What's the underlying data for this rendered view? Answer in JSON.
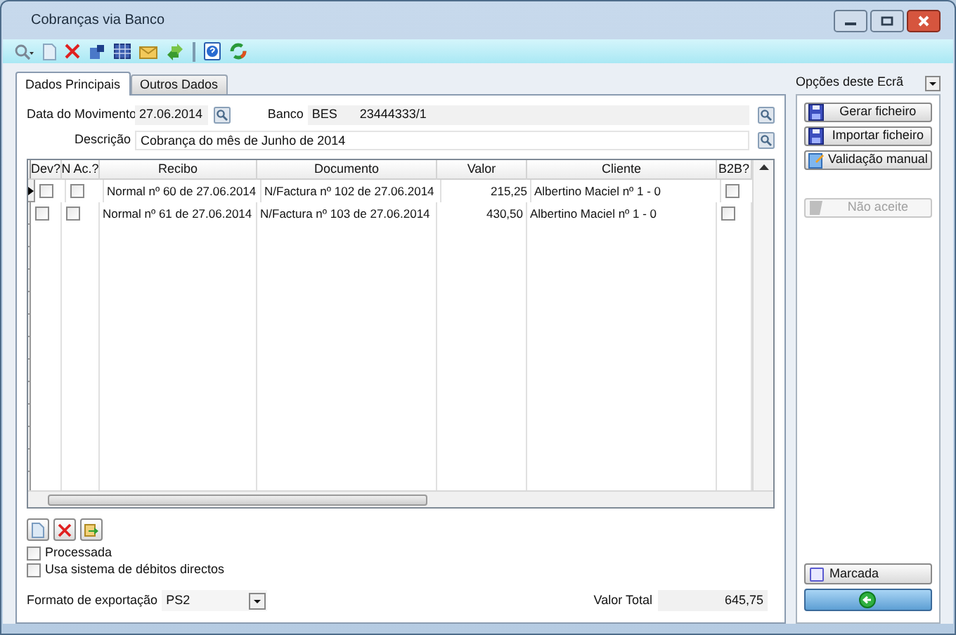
{
  "window": {
    "title": "Cobranças via Banco"
  },
  "tabs": [
    {
      "label": "Dados Principais",
      "selected": true
    },
    {
      "label": "Outros Dados",
      "selected": false
    }
  ],
  "fields": {
    "data_label": "Data do Movimento",
    "data_value": "27.06.2014",
    "banco_label": "Banco",
    "banco_code": "BES",
    "banco_account": "23444333/1",
    "descricao_label": "Descrição",
    "descricao_value": "Cobrança do mês de Junho de 2014"
  },
  "table": {
    "columns": [
      "Dev?",
      "N Ac.?",
      "Recibo",
      "Documento",
      "Valor",
      "Cliente",
      "B2B?"
    ],
    "rows": [
      {
        "selected": true,
        "dev": false,
        "n_ac": false,
        "recibo": "Normal nº 60 de 27.06.2014",
        "documento": "N/Factura nº 102 de 27.06.2014",
        "valor": "215,25",
        "cliente": "Albertino Maciel nº 1 - 0",
        "b2b": false
      },
      {
        "selected": false,
        "dev": false,
        "n_ac": false,
        "recibo": "Normal nº 61 de 27.06.2014",
        "documento": "N/Factura nº 103 de 27.06.2014",
        "valor": "430,50",
        "cliente": "Albertino Maciel nº 1 - 0",
        "b2b": false
      }
    ]
  },
  "options": [
    {
      "label": "Processada",
      "checked": false
    },
    {
      "label": "Usa sistema de débitos directos",
      "checked": false
    }
  ],
  "formato": {
    "label": "Formato de exportação",
    "value": "PS2"
  },
  "total": {
    "label": "Valor Total",
    "value": "645,75"
  },
  "side_panel": {
    "title": "Opções deste Ecrã",
    "buttons": [
      {
        "kind": "save",
        "label": "Gerar ficheiro",
        "disabled": false
      },
      {
        "kind": "save",
        "label": "Importar ficheiro",
        "disabled": false
      },
      {
        "kind": "edit",
        "label": "Validação manual",
        "disabled": false
      },
      {
        "kind": "flag",
        "label": "Não aceite",
        "disabled": true
      }
    ],
    "marcada": {
      "label": "Marcada",
      "checked": false
    }
  }
}
